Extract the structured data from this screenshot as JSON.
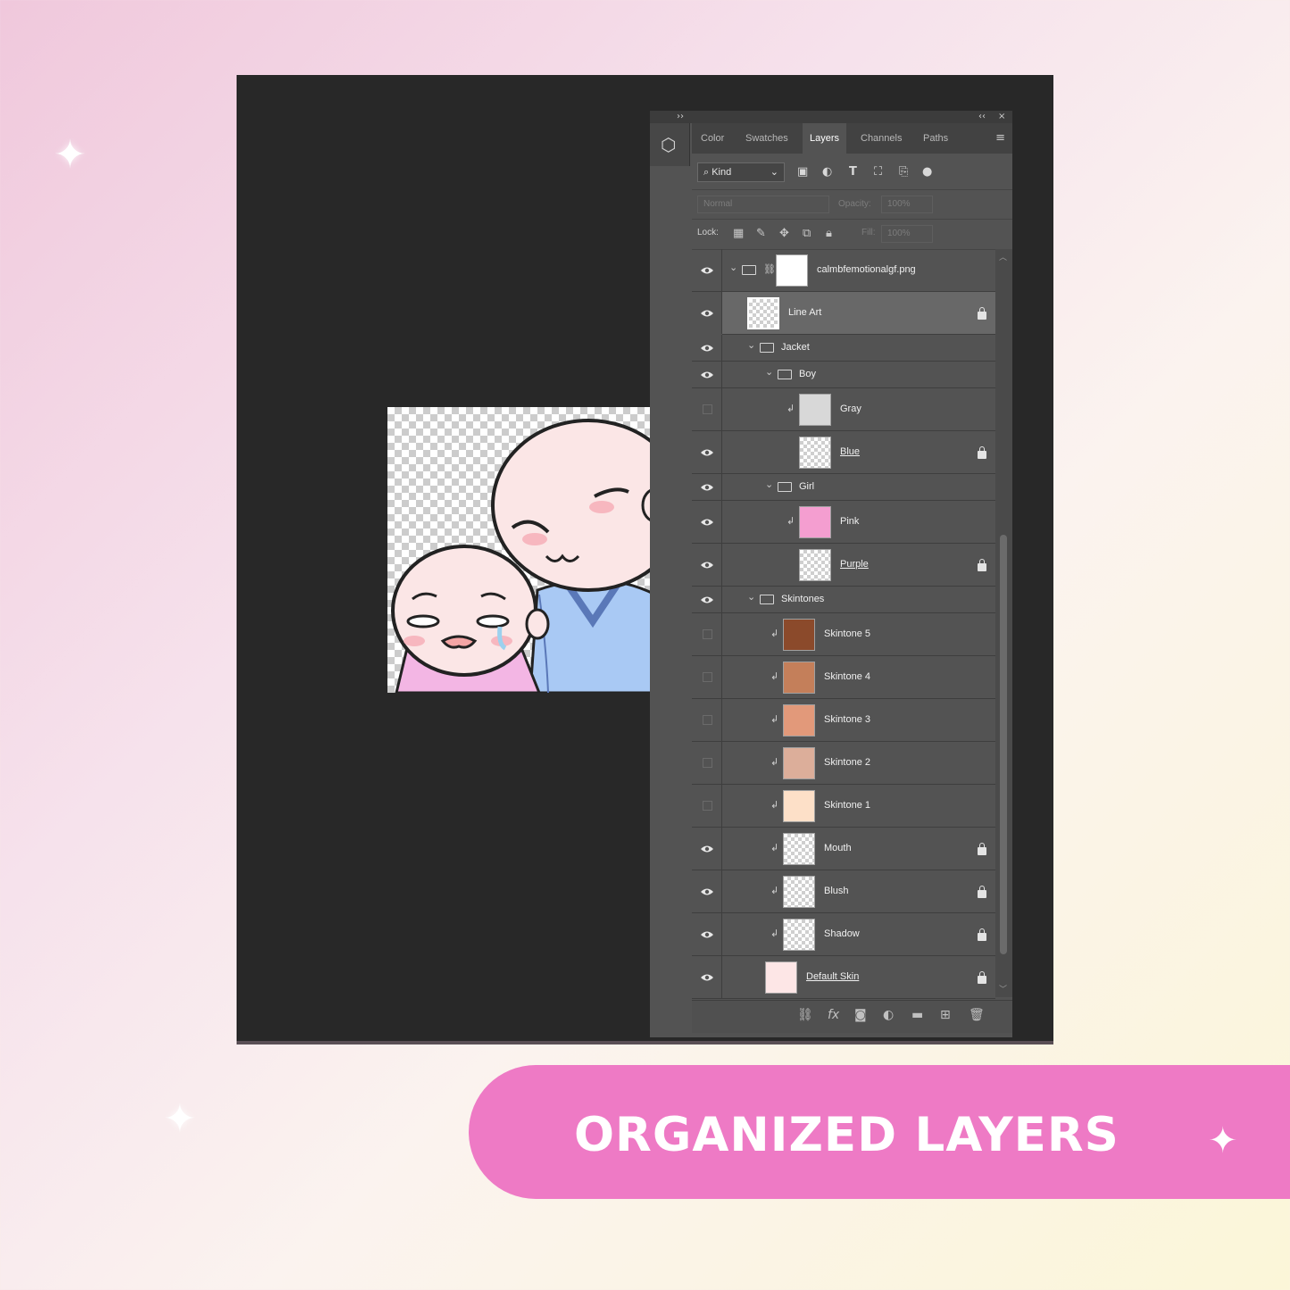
{
  "banner": {
    "title": "ORGANIZED LAYERS"
  },
  "panel": {
    "collapse_glyph": "››",
    "topbar_right": "‹‹",
    "close_glyph": "×",
    "tabs": [
      {
        "label": "Color",
        "active": false
      },
      {
        "label": "Swatches",
        "active": false
      },
      {
        "label": "Layers",
        "active": true
      },
      {
        "label": "Channels",
        "active": false
      },
      {
        "label": "Paths",
        "active": false
      }
    ],
    "filter": {
      "kind_label": "Kind"
    },
    "blend": {
      "mode": "Normal",
      "opacity_label": "Opacity:",
      "opacity_value": "100%"
    },
    "lock": {
      "label": "Lock:",
      "fill_label": "Fill:",
      "fill_value": "100%"
    }
  },
  "layers": [
    {
      "name": "calmbfemotionalgf.png",
      "visible": true,
      "type": "smart-group",
      "indent": 0,
      "locked": false
    },
    {
      "name": "Line Art",
      "visible": true,
      "type": "layer",
      "indent": 0,
      "locked": true,
      "selected": true
    },
    {
      "name": "Jacket",
      "visible": true,
      "type": "group",
      "indent": 1,
      "locked": false
    },
    {
      "name": "Boy",
      "visible": true,
      "type": "group",
      "indent": 2,
      "locked": false
    },
    {
      "name": "Gray",
      "visible": false,
      "type": "clipped",
      "indent": 3,
      "locked": false,
      "color": "#d8d8d8"
    },
    {
      "name": "Blue",
      "visible": true,
      "type": "layer",
      "indent": 3,
      "locked": true,
      "underline": true
    },
    {
      "name": "Girl",
      "visible": true,
      "type": "group",
      "indent": 2,
      "locked": false
    },
    {
      "name": "Pink",
      "visible": true,
      "type": "clipped",
      "indent": 3,
      "locked": false,
      "color": "#f49ed0"
    },
    {
      "name": "Purple",
      "visible": true,
      "type": "layer",
      "indent": 3,
      "locked": true,
      "underline": true
    },
    {
      "name": "Skintones",
      "visible": true,
      "type": "group",
      "indent": 1,
      "locked": false
    },
    {
      "name": "Skintone 5",
      "visible": false,
      "type": "clipped",
      "indent": 2,
      "locked": false,
      "color": "#8b4a2b"
    },
    {
      "name": "Skintone 4",
      "visible": false,
      "type": "clipped",
      "indent": 2,
      "locked": false,
      "color": "#c47f5a"
    },
    {
      "name": "Skintone 3",
      "visible": false,
      "type": "clipped",
      "indent": 2,
      "locked": false,
      "color": "#e2997a"
    },
    {
      "name": "Skintone 2",
      "visible": false,
      "type": "clipped",
      "indent": 2,
      "locked": false,
      "color": "#dcae9a"
    },
    {
      "name": "Skintone 1",
      "visible": false,
      "type": "clipped",
      "indent": 2,
      "locked": false,
      "color": "#fde0c8"
    },
    {
      "name": "Mouth",
      "visible": true,
      "type": "clipped",
      "indent": 2,
      "locked": true
    },
    {
      "name": "Blush",
      "visible": true,
      "type": "clipped",
      "indent": 2,
      "locked": true
    },
    {
      "name": "Shadow",
      "visible": true,
      "type": "clipped",
      "indent": 2,
      "locked": true
    },
    {
      "name": "Default Skin",
      "visible": true,
      "type": "layer",
      "indent": 1,
      "locked": true,
      "underline": true,
      "color": "#fde6e6"
    }
  ],
  "colors": {
    "banner": "#ee7ac5",
    "workspace": "#282828",
    "panel": "#535353"
  }
}
